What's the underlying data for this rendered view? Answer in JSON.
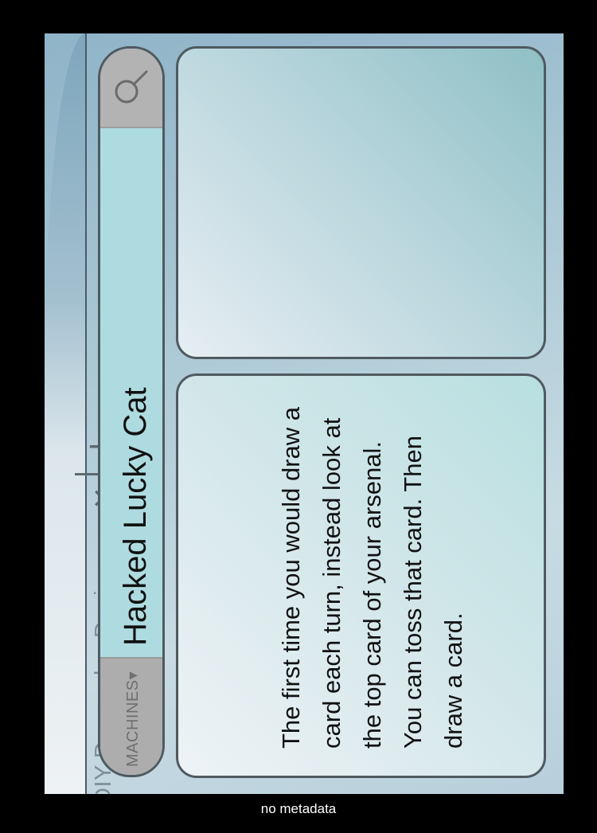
{
  "tab": {
    "title": "DIY Doomsday Devices",
    "close_glyph": "✕",
    "add_glyph": "+"
  },
  "card": {
    "type_label": "MACHINES▾",
    "name": "Hacked Lucky Cat",
    "rules_text": "The first time you would draw a card each turn, instead look at the top card of your arsenal. You can toss that card. Then draw a card.",
    "search_icon": "magnifier-icon"
  },
  "footer": {
    "text": "no metadata"
  },
  "colors": {
    "border": "#4f5a60",
    "title_bar": "#aedbe0",
    "grey_cap": "#b3b3b3"
  }
}
